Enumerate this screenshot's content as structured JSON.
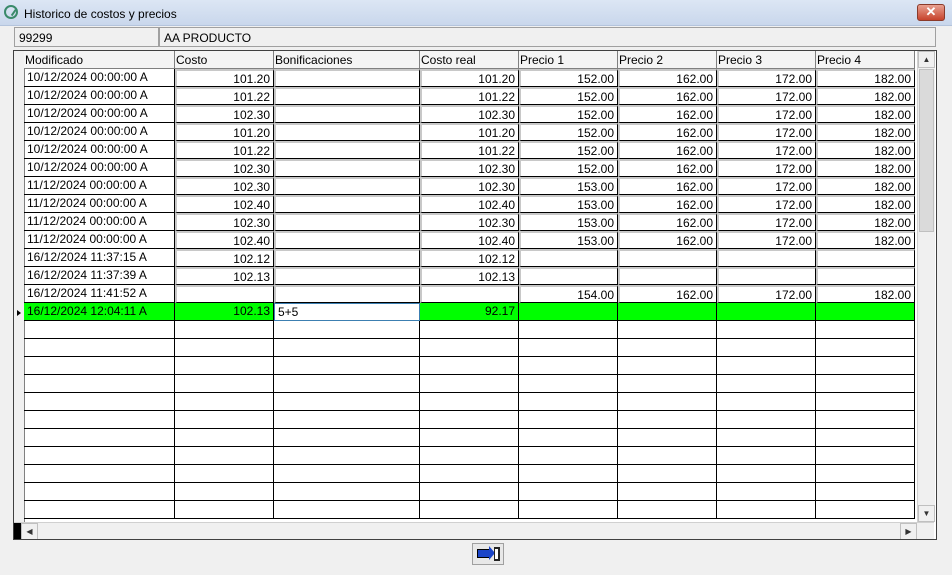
{
  "window": {
    "title": "Historico de costos y precios",
    "close_label": "✕"
  },
  "fields": {
    "code": "99299",
    "product": "AA PRODUCTO"
  },
  "grid": {
    "columns": [
      "Modificado",
      "Costo",
      "Bonificaciones",
      "Costo real",
      "Precio 1",
      "Precio 2",
      "Precio 3",
      "Precio 4"
    ],
    "rows": [
      [
        "10/12/2024 00:00:00 A",
        "101.20",
        "",
        "101.20",
        "152.00",
        "162.00",
        "172.00",
        "182.00"
      ],
      [
        "10/12/2024 00:00:00 A",
        "101.22",
        "",
        "101.22",
        "152.00",
        "162.00",
        "172.00",
        "182.00"
      ],
      [
        "10/12/2024 00:00:00 A",
        "102.30",
        "",
        "102.30",
        "152.00",
        "162.00",
        "172.00",
        "182.00"
      ],
      [
        "10/12/2024 00:00:00 A",
        "101.20",
        "",
        "101.20",
        "152.00",
        "162.00",
        "172.00",
        "182.00"
      ],
      [
        "10/12/2024 00:00:00 A",
        "101.22",
        "",
        "101.22",
        "152.00",
        "162.00",
        "172.00",
        "182.00"
      ],
      [
        "10/12/2024 00:00:00 A",
        "102.30",
        "",
        "102.30",
        "152.00",
        "162.00",
        "172.00",
        "182.00"
      ],
      [
        "11/12/2024 00:00:00 A",
        "102.30",
        "",
        "102.30",
        "153.00",
        "162.00",
        "172.00",
        "182.00"
      ],
      [
        "11/12/2024 00:00:00 A",
        "102.40",
        "",
        "102.40",
        "153.00",
        "162.00",
        "172.00",
        "182.00"
      ],
      [
        "11/12/2024 00:00:00 A",
        "102.30",
        "",
        "102.30",
        "153.00",
        "162.00",
        "172.00",
        "182.00"
      ],
      [
        "11/12/2024 00:00:00 A",
        "102.40",
        "",
        "102.40",
        "153.00",
        "162.00",
        "172.00",
        "182.00"
      ],
      [
        "16/12/2024 11:37:15 A",
        "102.12",
        "",
        "102.12",
        "",
        "",
        "",
        ""
      ],
      [
        "16/12/2024 11:37:39 A",
        "102.13",
        "",
        "102.13",
        "",
        "",
        "",
        ""
      ],
      [
        "16/12/2024 11:41:52 A",
        "",
        "",
        "",
        "154.00",
        "162.00",
        "172.00",
        "182.00"
      ],
      [
        "16/12/2024 12:04:11 A",
        "102.13",
        "5+5",
        "92.17",
        "",
        "",
        "",
        ""
      ]
    ],
    "selected_row": 13,
    "highlight_color": "#00ff00"
  },
  "icons": {
    "exit": "exit-door-icon"
  }
}
